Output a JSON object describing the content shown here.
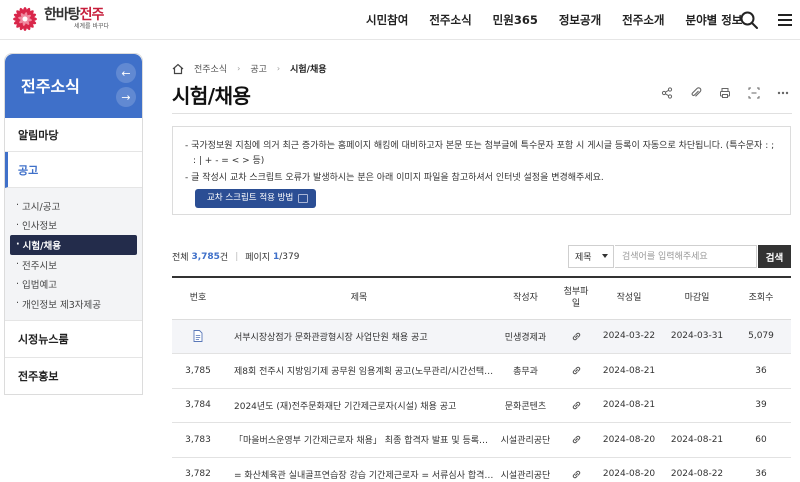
{
  "header": {
    "logo": {
      "main_prefix": "한바탕",
      "main_accent": "전주",
      "sub": "세계를 바꾸다"
    },
    "nav": [
      "시민참여",
      "전주소식",
      "민원365",
      "정보공개",
      "전주소개",
      "분야별 정보"
    ],
    "icons": [
      "search-icon",
      "menu-icon"
    ]
  },
  "lnb": {
    "title": "전주소식",
    "arrows": {
      "prev": "←",
      "next": "→"
    },
    "items": [
      {
        "label": "알림마당"
      },
      {
        "label": "공고"
      },
      {
        "label": "시정뉴스룸"
      },
      {
        "label": "전주홍보"
      }
    ],
    "sub_prefix": "·",
    "sub_items": [
      {
        "label": "고시/공고"
      },
      {
        "label": "인사정보"
      },
      {
        "label": "시험/채용"
      },
      {
        "label": "전주시보"
      },
      {
        "label": "입법예고"
      },
      {
        "label": "개인정보 제3자제공"
      }
    ]
  },
  "breadcrumb": {
    "items": [
      "전주소식",
      "공고"
    ],
    "current": "시험/채용",
    "separator": "›"
  },
  "page": {
    "title": "시험/채용"
  },
  "tools": [
    "share-icon",
    "attach-icon",
    "print-icon",
    "text-size-icon",
    "more-icon"
  ],
  "notice": {
    "line1": "- 국가정보원 지침에 의거 최근 증가하는 홈페이지 해킹에 대비하고자 본문 또는 첨부글에 특수문자 포함 시 게시글 등록이 자동으로 차단됩니다. (특수문자 : ; : | + - = < > 등)",
    "line2": "- 글 작성시 교차 스크립트 오류가 발생하시는 분은 아래 이미지 파일을 참고하셔서 인터넷 설정을 변경해주세요.",
    "button": "교차 스크립트 적용 방법"
  },
  "list": {
    "total_label": "전체",
    "total": "3,785",
    "total_unit": "건",
    "page_label": "페이지",
    "page_current": "1",
    "page_sep": " / ",
    "page_total": "379",
    "search": {
      "select": "제목",
      "placeholder": "검색어를 입력해주세요",
      "button": "검색"
    },
    "columns": [
      "번호",
      "제목",
      "작성자",
      "첨부파일",
      "작성일",
      "마감일",
      "조회수"
    ],
    "rows": [
      {
        "no": "",
        "notice": true,
        "title": "서부시장상점가 문화관광형시장 사업단원 채용 공고",
        "author": "민생경제과",
        "attach": true,
        "date": "2024-03-22",
        "deadline": "2024-03-31",
        "views": "5,079"
      },
      {
        "no": "3,785",
        "title": "제8회 전주시 지방임기제 공무원 임용계획 공고(노무관리/시간선택제...",
        "author": "총무과",
        "attach": true,
        "date": "2024-08-21",
        "deadline": "",
        "views": "36"
      },
      {
        "no": "3,784",
        "title": "2024년도 (재)전주문화재단 기간제근로자(시설) 채용 공고",
        "author": "문화콘텐츠",
        "attach": true,
        "date": "2024-08-21",
        "deadline": "",
        "views": "39"
      },
      {
        "no": "3,783",
        "title": "「마을버스운영부 기간제근로자 채용」 최종 합격자 발표 및 등록요령 공고",
        "author": "시설관리공단",
        "attach": true,
        "date": "2024-08-20",
        "deadline": "2024-08-21",
        "views": "60"
      },
      {
        "no": "3,782",
        "title": "= 화산체육관 실내골프연습장 강습 기간제근로자 = 서류심사 합격자 ...",
        "author": "시설관리공단",
        "attach": true,
        "date": "2024-08-20",
        "deadline": "2024-08-22",
        "views": "36"
      }
    ]
  },
  "colors": {
    "accent": "#3f70c9",
    "nav_dark": "#232c4b",
    "button": "#2b4e94",
    "logo_red": "#c71f3c"
  }
}
